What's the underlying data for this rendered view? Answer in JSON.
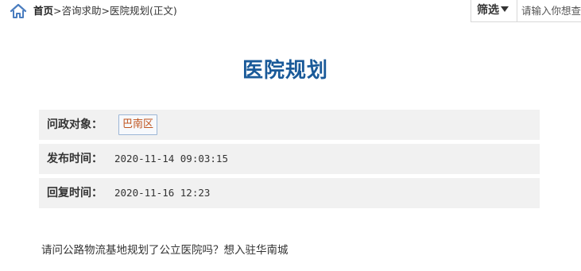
{
  "breadcrumb": {
    "home": "首页",
    "separator": ">",
    "section": "咨询求助",
    "current": "医院规划(正文)"
  },
  "filter": {
    "label": "筛选",
    "search_placeholder": "请输入你想查"
  },
  "title": "医院规划",
  "info": {
    "target_label": "问政对象：",
    "target_value": "巴南区",
    "publish_label": "发布时间：",
    "publish_value": "2020-11-14 09:03:15",
    "reply_label": "回复时间：",
    "reply_value": "2020-11-16 12:23"
  },
  "question": "请问公路物流基地规划了公立医院吗？想入驻华南城",
  "colors": {
    "title": "#1a5a99",
    "home_icon": "#4a7dbf",
    "tag_text": "#c0541e",
    "row_background": "#f1f1f1"
  }
}
